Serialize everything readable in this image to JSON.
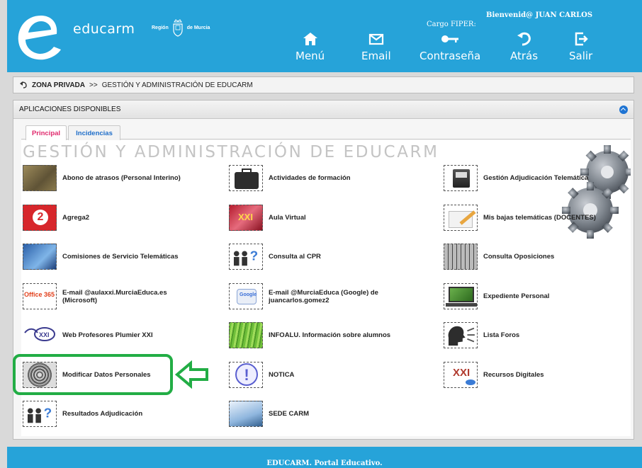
{
  "header": {
    "brand": "educarm",
    "region": "Región",
    "region_suffix": "de Murcia",
    "welcome": "Bienvenid@ JUAN CARLOS",
    "cargo": "Cargo FIPER:",
    "nav": [
      {
        "label": "Menú",
        "icon": "home-icon"
      },
      {
        "label": "Email",
        "icon": "mail-icon"
      },
      {
        "label": "Contraseña",
        "icon": "key-icon"
      },
      {
        "label": "Atrás",
        "icon": "back-icon"
      },
      {
        "label": "Salir",
        "icon": "exit-icon"
      }
    ],
    "bg_color": "#26a3d9"
  },
  "breadcrumb": {
    "root": "ZONA PRIVADA",
    "separator": ">>",
    "current": "GESTIÓN Y ADMINISTRACIÓN DE EDUCARM"
  },
  "panel": {
    "title": "APLICACIONES DISPONIBLES",
    "tabs": [
      {
        "label": "Principal",
        "active": true
      },
      {
        "label": "Incidencias",
        "active": false
      }
    ],
    "section_title": "GESTIÓN Y ADMINISTRACIÓN DE EDUCARM",
    "apps": [
      {
        "label": "Abono de atrasos (Personal Interino)",
        "icon": "coins-icon"
      },
      {
        "label": "Actividades de formación",
        "icon": "briefcase-icon"
      },
      {
        "label": "Gestión Adjudicación Telemática",
        "icon": "printer-icon"
      },
      {
        "label": "Agrega2",
        "icon": "agrega2-icon"
      },
      {
        "label": "Aula Virtual",
        "icon": "aula-virtual-icon"
      },
      {
        "label": "Mis bajas telemáticas (DOCENTES)",
        "icon": "pencil-icon"
      },
      {
        "label": "Comisiones de Servicio Telemáticas",
        "icon": "globe-computer-icon"
      },
      {
        "label": "Consulta al CPR",
        "icon": "people-question-icon"
      },
      {
        "label": "Consulta Oposiciones",
        "icon": "keyboard-icon"
      },
      {
        "label": "E-mail @aulaxxi.MurciaEduca.es (Microsoft)",
        "icon": "office365-icon"
      },
      {
        "label": "E-mail @MurciaEduca (Google) de juancarlos.gomez2",
        "icon": "google-icon"
      },
      {
        "label": "Expediente Personal",
        "icon": "laptop-chart-icon"
      },
      {
        "label": "Web Profesores Plumier XXI",
        "icon": "plumier-icon"
      },
      {
        "label": "INFOALU. Información sobre alumnos",
        "icon": "grass-icon"
      },
      {
        "label": "Lista Foros",
        "icon": "speaking-head-icon"
      },
      {
        "label": "Modificar Datos Personales",
        "icon": "fingerprint-icon"
      },
      {
        "label": "NOTICA",
        "icon": "exclamation-icon"
      },
      {
        "label": "Recursos Digitales",
        "icon": "recursos-icon"
      },
      {
        "label": "Resultados Adjudicación",
        "icon": "people-question-icon"
      },
      {
        "label": "SEDE CARM",
        "icon": "sede-laptop-icon"
      }
    ]
  },
  "footer": {
    "text": "EDUCARM. Portal Educativo."
  },
  "highlight_color": "#22ad45"
}
